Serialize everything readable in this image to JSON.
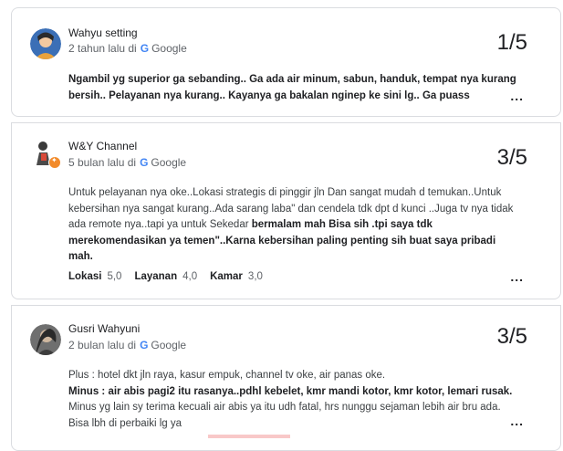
{
  "reviews": [
    {
      "author": "Wahyu setting",
      "time_prefix": "2 tahun lalu di",
      "source": "Google",
      "rating": "1/5",
      "segments": [
        {
          "text": "Ngambil yg superior ga sebanding.. Ga ada air minum, sabun, handuk, tempat nya kurang bersih.. Pelayanan nya kurang.. Kayanya ga bakalan nginep ke sini lg.. Ga puass",
          "bold": true
        }
      ],
      "more": "..."
    },
    {
      "author": "W&Y Channel",
      "time_prefix": "5 bulan lalu di",
      "source": "Google",
      "rating": "3/5",
      "segments": [
        {
          "text": "Untuk pelayanan nya oke..Lokasi strategis di pinggir jln Dan sangat mudah d temukan..Untuk kebersihan nya sangat kurang..Ada sarang laba\" dan cendela tdk dpt d kunci ..Juga tv nya tidak ada remote nya..tapi ya untuk Sekedar ",
          "bold": false
        },
        {
          "text": "bermalam mah Bisa sih .tpi saya tdk merekomendasikan ya temen\"..Karna kebersihan paling penting sih buat saya pribadi mah.",
          "bold": true
        }
      ],
      "aspects": [
        {
          "label": "Lokasi",
          "value": "5,0"
        },
        {
          "label": "Layanan",
          "value": "4,0"
        },
        {
          "label": "Kamar",
          "value": "3,0"
        }
      ],
      "more": "..."
    },
    {
      "author": "Gusri Wahyuni",
      "time_prefix": "2 bulan lalu di",
      "source": "Google",
      "rating": "3/5",
      "segments": [
        {
          "text": "Plus : hotel dkt jln raya, kasur empuk, channel tv oke, air panas oke.",
          "bold": false
        },
        {
          "text": "Minus : air abis pagi2 itu rasanya..pdhl kebelet, kmr mandi kotor, kmr kotor, lemari rusak.",
          "bold": true
        },
        {
          "text": "Minus yg lain sy terima kecuali air abis ya itu udh fatal, hrs nunggu sejaman lebih air bru ada. Bisa lbh di perbaiki lg ya",
          "bold": false
        }
      ],
      "more": "..."
    }
  ],
  "icons": {
    "google": "G",
    "local-guide-badge": "star"
  },
  "colors": {
    "google_blue": "#4285f4",
    "badge_orange": "#f28b2b",
    "border": "#dadce0"
  }
}
